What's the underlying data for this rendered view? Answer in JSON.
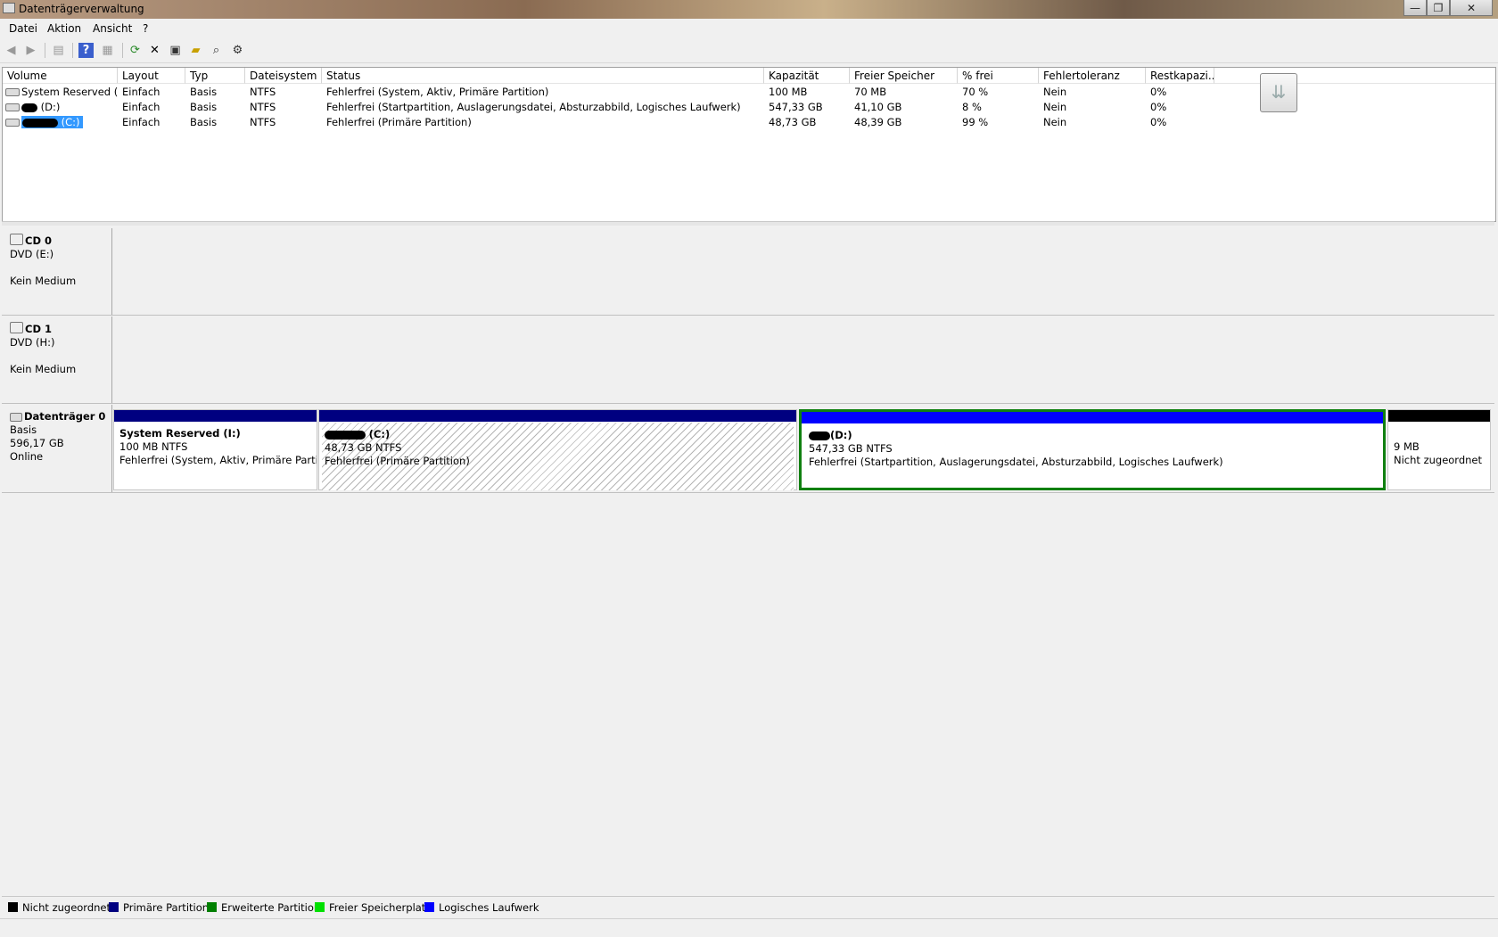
{
  "window": {
    "title": "Datenträgerverwaltung",
    "minimize": "—",
    "maximize": "❐",
    "close": "✕"
  },
  "menu": [
    "Datei",
    "Aktion",
    "Ansicht",
    "?"
  ],
  "toolbar": {
    "back": "◀",
    "forward": "▶",
    "show_hide": "▤",
    "help": "?",
    "properties_list": "▦",
    "refresh": "⟳",
    "delete": "✕",
    "properties": "▣",
    "open": "▰",
    "explore": "⌕",
    "settings": "⚙"
  },
  "columns": [
    "Volume",
    "Layout",
    "Typ",
    "Dateisystem",
    "Status",
    "Kapazität",
    "Freier Speicher",
    "% frei",
    "Fehlertoleranz",
    "Restkapazi..."
  ],
  "volumes": [
    {
      "name": "System Reserved (I:)",
      "layout": "Einfach",
      "typ": "Basis",
      "fs": "NTFS",
      "status": "Fehlerfrei (System, Aktiv, Primäre Partition)",
      "capacity": "100 MB",
      "free": "70 MB",
      "pct": "70 %",
      "fault": "Nein",
      "rest": "0%"
    },
    {
      "name": "(D:)",
      "layout": "Einfach",
      "typ": "Basis",
      "fs": "NTFS",
      "status": "Fehlerfrei (Startpartition, Auslagerungsdatei, Absturzabbild, Logisches Laufwerk)",
      "capacity": "547,33 GB",
      "free": "41,10 GB",
      "pct": "8 %",
      "fault": "Nein",
      "rest": "0%"
    },
    {
      "name": "(C:)",
      "layout": "Einfach",
      "typ": "Basis",
      "fs": "NTFS",
      "status": "Fehlerfrei (Primäre Partition)",
      "capacity": "48,73 GB",
      "free": "48,39 GB",
      "pct": "99 %",
      "fault": "Nein",
      "rest": "0%"
    }
  ],
  "scroll_icon": "⇊",
  "cd0": {
    "name": "CD 0",
    "drive": "DVD (E:)",
    "media": "Kein Medium"
  },
  "cd1": {
    "name": "CD 1",
    "drive": "DVD (H:)",
    "media": "Kein Medium"
  },
  "disk0": {
    "name": "Datenträger 0",
    "type": "Basis",
    "size": "596,17 GB",
    "state": "Online",
    "partitions": [
      {
        "title": "System Reserved  (I:)",
        "size": "100 MB NTFS",
        "status": "Fehlerfrei (System, Aktiv, Primäre Partition)"
      },
      {
        "title": "(C:)",
        "size": "48,73 GB NTFS",
        "status": "Fehlerfrei (Primäre Partition)"
      },
      {
        "title": "(D:)",
        "size": "547,33 GB NTFS",
        "status": "Fehlerfrei (Startpartition, Auslagerungsdatei, Absturzabbild, Logisches Laufwerk)"
      },
      {
        "title": "",
        "size": "9 MB",
        "status": "Nicht zugeordnet"
      }
    ]
  },
  "legend": [
    {
      "label": "Nicht zugeordnet",
      "color": "#000000"
    },
    {
      "label": "Primäre Partition",
      "color": "#000080"
    },
    {
      "label": "Erweiterte Partition",
      "color": "#008000"
    },
    {
      "label": "Freier Speicherplatz",
      "color": "#00e000"
    },
    {
      "label": "Logisches Laufwerk",
      "color": "#0000ff"
    }
  ]
}
